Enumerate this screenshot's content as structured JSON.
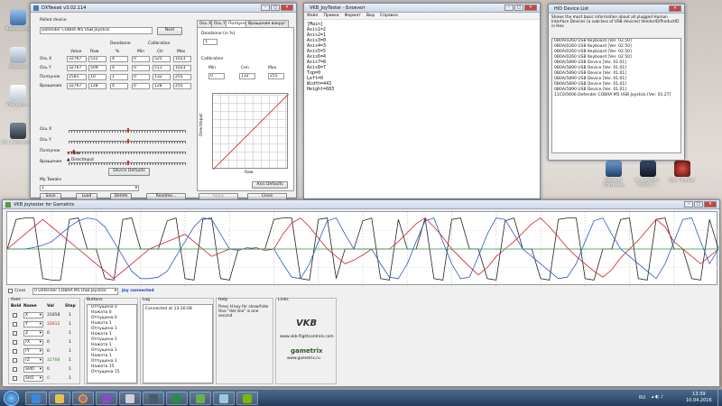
{
  "desktop": {
    "icons_left": [
      "Компьютер",
      "Корзина",
      "VKB_joyte...",
      "Это компьютер"
    ],
    "icons_right": [
      "World of Warplanes",
      "Air Conflicts - Pacific C...",
      "War Thunder"
    ]
  },
  "dxtweak": {
    "title": "DXTweak v3.02.114",
    "polled_label": "Polled device",
    "device": "Defender COBRA M5 USB Joystick",
    "next": "Next",
    "hdr_deadzone": "Deadzone",
    "hdr_calibration": "Calibration",
    "cols": [
      "Value",
      "Raw",
      "%",
      "Min",
      "Ctr",
      "Max"
    ],
    "rows": [
      {
        "label": "Ось X",
        "v": [
          "32767",
          "512",
          "4",
          "0",
          "525",
          "1023"
        ]
      },
      {
        "label": "Ось Y",
        "v": [
          "32767",
          "509",
          "4",
          "0",
          "511",
          "1023"
        ]
      },
      {
        "label": "Ползунок",
        "v": [
          "2581",
          "10",
          "1",
          "0",
          "132",
          "255"
        ]
      },
      {
        "label": "Вращение",
        "v": [
          "32767",
          "128",
          "4",
          "0",
          "128",
          "255"
        ]
      }
    ],
    "sliders": [
      {
        "label": "Ось X",
        "pos": 0.5
      },
      {
        "label": "Ось Y",
        "pos": 0.5
      },
      {
        "label": "Ползунок",
        "pos": 0.04
      },
      {
        "label": "Вращение",
        "pos": 0.5
      }
    ],
    "legend_raw": "Raw",
    "legend_direct": "DirectInput",
    "device_defaults": "Device Defaults",
    "tweaks_label": "My Tweaks",
    "tweak_value": "1",
    "save": "Save",
    "load": "Load",
    "delete": "Delete",
    "readme": "Readme...",
    "apply": "Apply",
    "close": "Close",
    "tabs": [
      "Ось X",
      "Ось Y",
      "Ползунок",
      "Вращение вокруг"
    ],
    "deadzone_title": "Deadzone (in %)",
    "deadzone_value": "1",
    "calib_title": "Calibration",
    "calib_cols": [
      "Min",
      "Cen",
      "Max"
    ],
    "calib_vals": [
      "0",
      "132",
      "255"
    ],
    "axis_y_label": "DirectInput",
    "axis_x_label": "Raw",
    "axis_defaults": "Axis Defaults"
  },
  "notepad": {
    "title": "VKB_JoyTester - Блокнот",
    "menu": [
      "Файл",
      "Правка",
      "Формат",
      "Вид",
      "Справка"
    ],
    "lines": [
      "[Main]",
      "Axis1=2",
      "Axis2=1",
      "Axis3=0",
      "Axis4=3",
      "Axis5=5",
      "Axis6=4",
      "Axis7=8",
      "Axis8=7",
      "Top=0",
      "Left=0",
      "Width=443",
      "Height=683"
    ]
  },
  "hid": {
    "title": "HID Device List",
    "desc": "Shows the most basic information about all plugged Human Interface Devices (a subclass of USB devices) VendorID/ProductID in Hex",
    "devices": [
      "0B0A/0260 USB Keyboard [Ver. 02.50]",
      "0B0A/0260 USB Keyboard [Ver. 02.50]",
      "0B0A/0260 USB Keyboard [Ver. 02.50]",
      "0B0A/0260 USB Keyboard [Ver. 02.50]",
      "0B0A/5890 USB Device [Ver. 01.01]",
      "0B0A/5890 USB Device [Ver. 01.01]",
      "0B0A/5890 USB Device [Ver. 01.01]",
      "0B0A/5890 USB Device [Ver. 01.01]",
      "0B0A/5890 USB Device [Ver. 01.01]",
      "0B0A/5890 USB Device [Ver. 01.01]",
      "11C0/5606 Defender COBRA M5 USB Joystick [Ver. 01.27]"
    ]
  },
  "vkb": {
    "title": "VKB joytester for Gametrix",
    "cross_label": "Cross",
    "device_select": "0 Defender COBRA M5 USB Joystick",
    "status": "Joy connected",
    "axes_title": "Axes",
    "axes_cols": [
      "Bold",
      "Name",
      "Val",
      "Step"
    ],
    "axes": [
      {
        "name": "X",
        "val": "31858",
        "step": "1",
        "color": "#1a1a1a"
      },
      {
        "name": "Y",
        "val": "32812",
        "step": "1",
        "color": "#d0202a"
      },
      {
        "name": "Z",
        "val": "0",
        "step": "1",
        "color": "#1a1a1a"
      },
      {
        "name": "rX",
        "val": "0",
        "step": "1",
        "color": "#1a1a1a"
      },
      {
        "name": "rY",
        "val": "0",
        "step": "1",
        "color": "#1a1a1a"
      },
      {
        "name": "rZ",
        "val": "32768",
        "step": "1",
        "color": "#2a9a3a"
      },
      {
        "name": "Sld0",
        "val": "0",
        "step": "1",
        "color": "#1a1a1a"
      },
      {
        "name": "Sld1",
        "val": "0",
        "step": "1",
        "color": "#c040c0"
      }
    ],
    "buttons_title": "Buttons",
    "buttons_log": [
      "Отпущена 0",
      "Нажата 0",
      "Отпущена 0",
      "Нажата 1",
      "Отпущена 1",
      "Нажата 1",
      "Отпущена 1",
      "Нажата 1",
      "Отпущена 1",
      "Нажата 1",
      "Отпущена 1",
      "Нажата 15",
      "Отпущена 15"
    ],
    "log_title": "Log",
    "log_text": "Connected at 13:16:08",
    "help_title": "Help",
    "help_text": "Press H key for show/hide One \"dot line\" is one second",
    "links_title": "Links",
    "link1_logo": "VKB",
    "link1": "www.vkb-flightcontrols.com",
    "link2_logo": "gametrix",
    "link2": "www.gametrix.ru"
  },
  "taskbar": {
    "lang": "RU",
    "time": "13:39",
    "date": "10.04.2016"
  },
  "chart_data": {
    "type": "line",
    "title": "",
    "xlabel": "",
    "ylabel": "",
    "ylim": [
      0,
      100
    ],
    "grid": true,
    "x": [
      0,
      1,
      2,
      3,
      4,
      5,
      6,
      7,
      8,
      9,
      10,
      11,
      12,
      13,
      14,
      15,
      16,
      17,
      18,
      19,
      20,
      21,
      22,
      23,
      24,
      25,
      26,
      27,
      28,
      29,
      30,
      31,
      32,
      33,
      34,
      35,
      36,
      37,
      38,
      39,
      40,
      41,
      42,
      43,
      44,
      45,
      46,
      47,
      48,
      49,
      50,
      51,
      52,
      53,
      54,
      55,
      56,
      57,
      58,
      59,
      60,
      61,
      62,
      63,
      64,
      65,
      66,
      67,
      68,
      69,
      70,
      71,
      72,
      73,
      74,
      75,
      76,
      77,
      78,
      79,
      80
    ],
    "series": [
      {
        "color": "#222222",
        "values": [
          50,
          90,
          92,
          92,
          10,
          8,
          8,
          90,
          92,
          50,
          50,
          10,
          8,
          90,
          92,
          50,
          50,
          50,
          88,
          92,
          10,
          8,
          90,
          92,
          10,
          8,
          50,
          50,
          50,
          50,
          90,
          92,
          92,
          10,
          8,
          90,
          92,
          10,
          50,
          50,
          88,
          92,
          10,
          8,
          90,
          50,
          50,
          92,
          10,
          8,
          90,
          92,
          50,
          50,
          10,
          8,
          88,
          92,
          50,
          50,
          10,
          8,
          90,
          92,
          92,
          10,
          8,
          50,
          50,
          90,
          92,
          10,
          8,
          90,
          92,
          50,
          50,
          10,
          8,
          90,
          50
        ]
      },
      {
        "color": "#d0202a",
        "values": [
          50,
          60,
          70,
          80,
          90,
          80,
          70,
          60,
          50,
          40,
          30,
          20,
          10,
          20,
          30,
          40,
          50,
          55,
          60,
          65,
          70,
          60,
          50,
          40,
          45,
          50,
          50,
          50,
          52,
          48,
          50,
          70,
          85,
          92,
          80,
          65,
          50,
          40,
          30,
          35,
          42,
          50,
          50,
          50,
          60,
          72,
          84,
          92,
          80,
          66,
          50,
          38,
          26,
          15,
          25,
          40,
          50,
          60,
          72,
          84,
          92,
          80,
          66,
          52,
          40,
          30,
          20,
          12,
          22,
          38,
          50,
          62,
          76,
          90,
          80,
          60,
          50,
          40,
          30,
          40,
          50
        ]
      },
      {
        "color": "#2a5ac8",
        "values": [
          50,
          50,
          50,
          52,
          55,
          60,
          70,
          80,
          88,
          92,
          90,
          80,
          60,
          40,
          20,
          10,
          10,
          12,
          20,
          40,
          60,
          80,
          92,
          90,
          70,
          50,
          50,
          50,
          50,
          50,
          50,
          30,
          12,
          10,
          30,
          60,
          88,
          92,
          70,
          50,
          50,
          50,
          30,
          12,
          10,
          30,
          60,
          88,
          92,
          60,
          30,
          10,
          12,
          40,
          70,
          92,
          90,
          70,
          50,
          40,
          30,
          20,
          10,
          12,
          30,
          60,
          88,
          92,
          70,
          50,
          40,
          30,
          20,
          10,
          30,
          60,
          90,
          92,
          60,
          30,
          50
        ]
      },
      {
        "color": "#2a9a3a",
        "values": [
          50,
          50,
          50,
          50,
          50,
          50,
          50,
          50,
          50,
          50,
          50,
          50,
          50,
          50,
          50,
          50,
          50,
          50,
          50,
          50,
          50,
          50,
          50,
          50,
          50,
          50,
          48,
          52,
          50,
          50,
          50,
          50,
          50,
          50,
          50,
          50,
          50,
          50,
          50,
          50,
          50,
          50,
          50,
          50,
          50,
          50,
          50,
          50,
          50,
          50,
          50,
          50,
          50,
          50,
          50,
          50,
          50,
          50,
          50,
          50,
          50,
          50,
          50,
          50,
          50,
          50,
          50,
          50,
          50,
          50,
          50,
          50,
          50,
          50,
          50,
          50,
          50,
          50,
          50,
          50,
          50
        ]
      }
    ]
  }
}
